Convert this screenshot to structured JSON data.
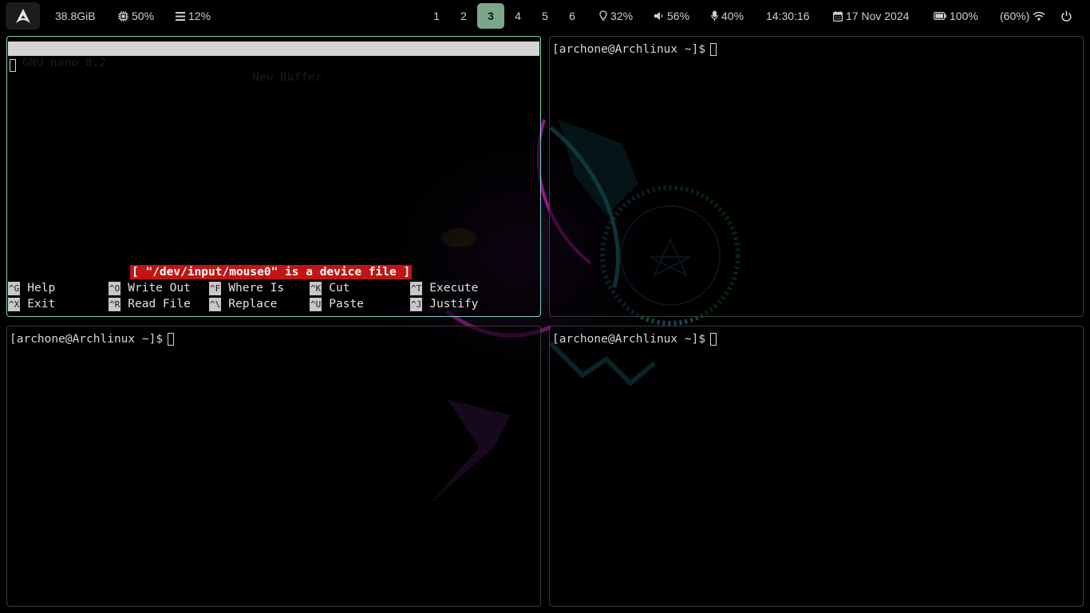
{
  "topbar": {
    "disk": "38.8GiB",
    "cpu": "50%",
    "memory": "12%",
    "workspaces": [
      "1",
      "2",
      "3",
      "4",
      "5",
      "6"
    ],
    "active_workspace": "3",
    "brightness": "32%",
    "volume": "56%",
    "mic": "40%",
    "clock": "14:30:16",
    "date": "17 Nov 2024",
    "battery": "100%",
    "wifi": "(60%)"
  },
  "icons": {
    "launcher": "arch-logo-icon",
    "cpu": "chip-icon",
    "memory": "bars-icon",
    "brightness": "bulb-icon",
    "volume": "speaker-icon",
    "mic": "microphone-icon",
    "date": "calendar-icon",
    "battery": "battery-icon",
    "wifi": "wifi-icon",
    "power": "power-icon"
  },
  "colors": {
    "active_workspace": "#7ba688",
    "focused_border": "#7ccfc7",
    "nano_status_bg": "#c21414"
  },
  "nano": {
    "version": "GNU nano 8.2",
    "buffer": "New Buffer",
    "status": "[ \"/dev/input/mouse0\" is a device file ]",
    "shortcuts_row1": [
      {
        "key": "^G",
        "label": "Help"
      },
      {
        "key": "^O",
        "label": "Write Out"
      },
      {
        "key": "^F",
        "label": "Where Is"
      },
      {
        "key": "^K",
        "label": "Cut"
      },
      {
        "key": "^T",
        "label": "Execute"
      }
    ],
    "shortcuts_row2": [
      {
        "key": "^X",
        "label": "Exit"
      },
      {
        "key": "^R",
        "label": "Read File"
      },
      {
        "key": "^\\",
        "label": "Replace"
      },
      {
        "key": "^U",
        "label": "Paste"
      },
      {
        "key": "^J",
        "label": "Justify"
      }
    ]
  },
  "terminals": {
    "top_right_prompt": "[archone@Archlinux ~]$",
    "bottom_left_prompt": "[archone@Archlinux ~]$",
    "bottom_right_prompt": "[archone@Archlinux ~]$"
  }
}
